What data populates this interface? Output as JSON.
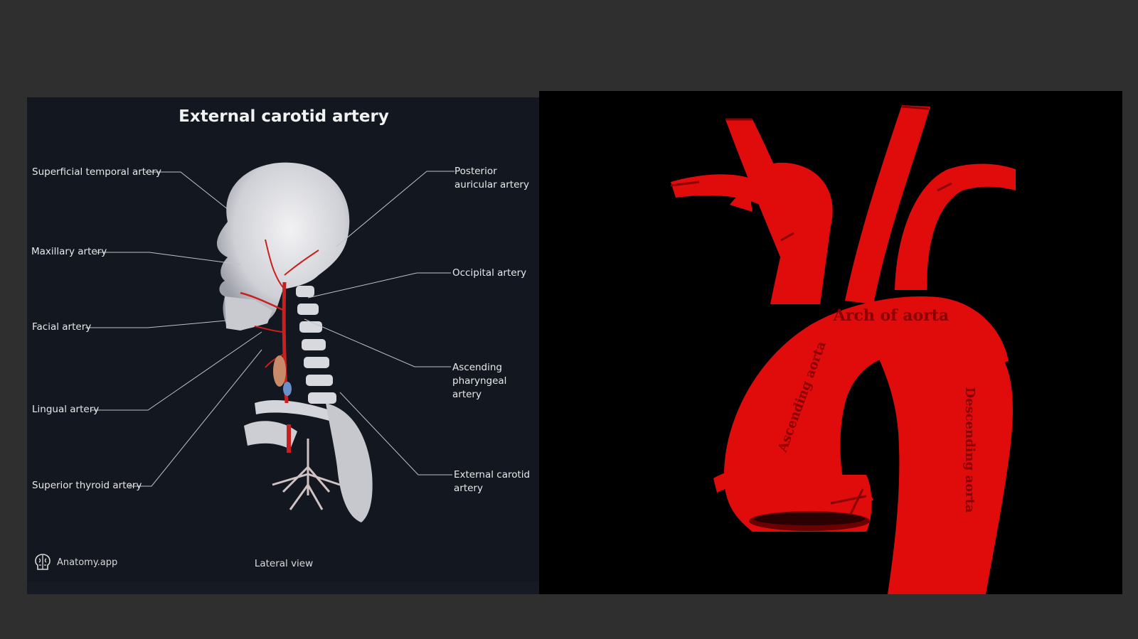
{
  "left_panel": {
    "title": "External carotid artery",
    "labels": {
      "superficial_temporal": "Superficial temporal artery",
      "maxillary": "Maxillary artery",
      "facial": "Facial artery",
      "lingual": "Lingual artery",
      "superior_thyroid": "Superior thyroid artery",
      "posterior_auricular": "Posterior auricular artery",
      "occipital": "Occipital artery",
      "ascending_pharyngeal": "Ascending pharyngeal artery",
      "external_carotid": "External carotid artery"
    },
    "caption": "Lateral view",
    "brand": "Anatomy.app"
  },
  "right_panel": {
    "labels": {
      "arch": "Arch of aorta",
      "ascending": "Ascending aorta",
      "descending": "Descending aorta"
    },
    "colors": {
      "vessel": "#e00b0b",
      "vessel_dark": "#8a0000",
      "background": "#000000"
    }
  },
  "icons": [
    "brain-icon"
  ]
}
